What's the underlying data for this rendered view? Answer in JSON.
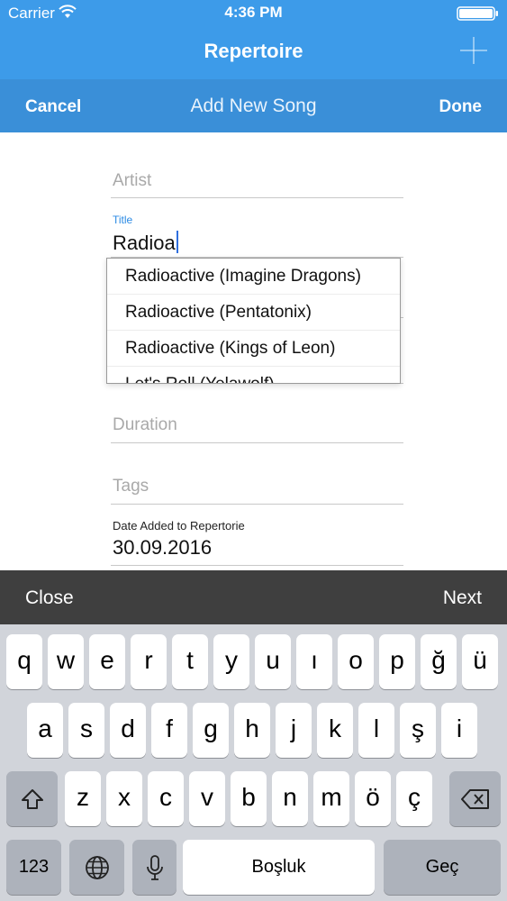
{
  "status_bar": {
    "carrier": "Carrier",
    "time": "4:36 PM"
  },
  "app_bar": {
    "title": "Repertoire"
  },
  "form_bar": {
    "cancel_label": "Cancel",
    "title": "Add New Song",
    "done_label": "Done"
  },
  "form": {
    "artist_placeholder": "Artist",
    "title_label": "Title",
    "title_value": "Radioa",
    "duration_placeholder": "Duration",
    "tags_placeholder": "Tags",
    "date_label": "Date Added to Repertorie",
    "date_value": "30.09.2016"
  },
  "suggestions": [
    "Radioactive (Imagine Dragons)",
    "Radioactive (Pentatonix)",
    "Radioactive (Kings of Leon)",
    "Let's Roll (Yelawolf)"
  ],
  "accessory_bar": {
    "close_label": "Close",
    "next_label": "Next"
  },
  "keyboard": {
    "row1": [
      "q",
      "w",
      "e",
      "r",
      "t",
      "y",
      "u",
      "ı",
      "o",
      "p",
      "ğ",
      "ü"
    ],
    "row2": [
      "a",
      "s",
      "d",
      "f",
      "g",
      "h",
      "j",
      "k",
      "l",
      "ş",
      "i"
    ],
    "row3": [
      "z",
      "x",
      "c",
      "v",
      "b",
      "n",
      "m",
      "ö",
      "ç"
    ],
    "numbers_label": "123",
    "space_label": "Boşluk",
    "return_label": "Geç",
    "icons": {
      "shift": "shift-icon",
      "backspace": "backspace-icon",
      "globe": "globe-icon",
      "mic": "microphone-icon"
    }
  },
  "colors": {
    "nav_blue": "#3d9be9",
    "sub_bar_blue": "#3a8fd8",
    "accent": "#2b8ae4",
    "accessory_bar": "#3f3f3f",
    "keyboard_bg": "#d1d4da"
  }
}
